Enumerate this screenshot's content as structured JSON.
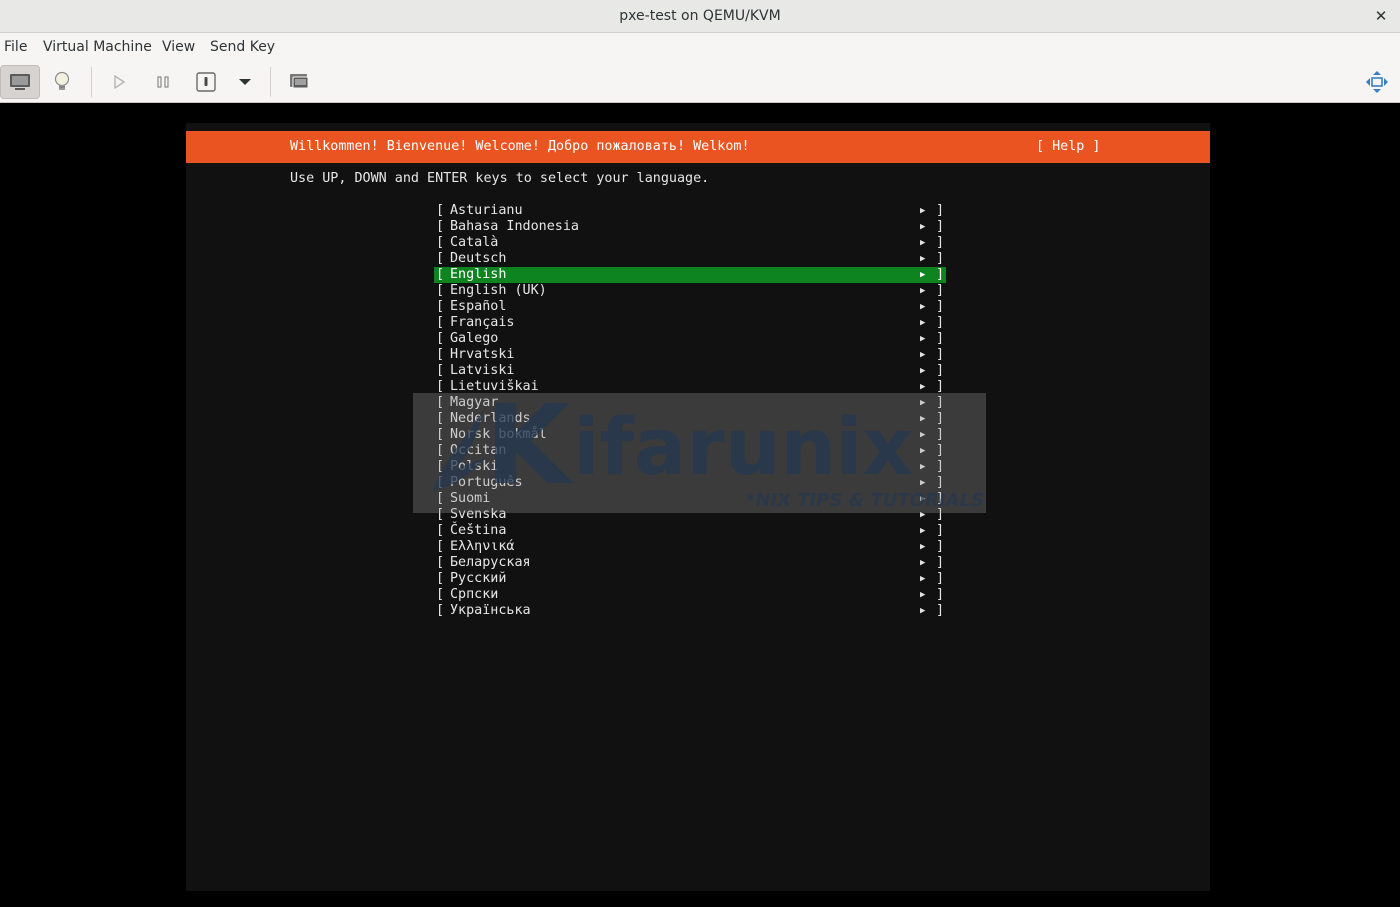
{
  "window": {
    "title": "pxe-test on QEMU/KVM",
    "close_glyph": "✕"
  },
  "menubar": {
    "items": [
      "File",
      "Virtual Machine",
      "View",
      "Send Key"
    ]
  },
  "toolbar": {
    "icons": [
      "console-icon",
      "lightbulb-icon",
      "play-icon",
      "pause-icon",
      "power-icon",
      "dropdown-arrow-icon",
      "snapshots-icon",
      "fullscreen-icon"
    ]
  },
  "installer": {
    "header": "Willkommen! Bienvenue! Welcome! Добро пожаловать! Welkom!",
    "help": "[ Help ]",
    "instruction": "Use UP, DOWN and ENTER keys to select your language.",
    "bracket_left": "[",
    "bracket_right": "]",
    "arrow": "▶",
    "selected": "English",
    "languages": [
      "Asturianu",
      "Bahasa Indonesia",
      "Català",
      "Deutsch",
      "English",
      "English (UK)",
      "Español",
      "Français",
      "Galego",
      "Hrvatski",
      "Latviski",
      "Lietuviškai",
      "Magyar",
      "Nederlands",
      "Norsk bokmål",
      "Occitan",
      "Polski",
      "Português",
      "Suomi",
      "Svenska",
      "Čeština",
      "Ελληνικά",
      "Беларуская",
      "Русский",
      "Српски",
      "Українська"
    ]
  },
  "colors": {
    "header_orange": "#e95420",
    "selected_green": "#0e8420",
    "screen_bg": "#111111"
  },
  "watermark": {
    "brand": "ifarunix",
    "brand_initial": "K",
    "tagline": "*NIX TIPS & TUTORIALS"
  }
}
